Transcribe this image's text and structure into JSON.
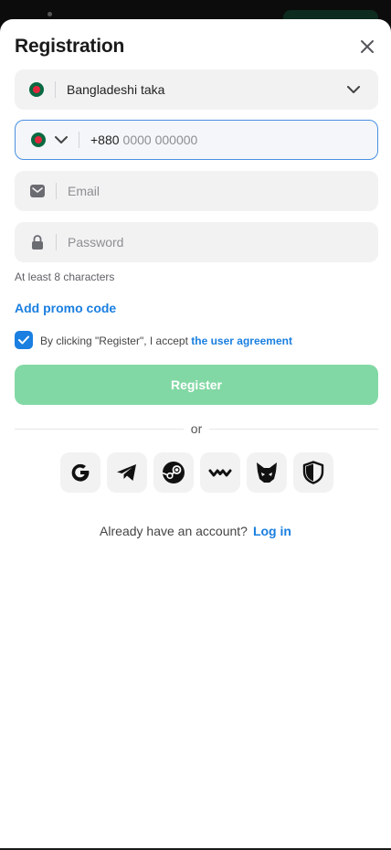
{
  "header": {
    "title": "Registration"
  },
  "currency": {
    "value": "Bangladeshi taka",
    "flag": "bangladesh-flag"
  },
  "phone": {
    "code": "+880",
    "placeholder": "0000 000000"
  },
  "email": {
    "placeholder": "Email"
  },
  "password": {
    "placeholder": "Password",
    "hint": "At least 8 characters"
  },
  "promo": {
    "label": "Add promo code"
  },
  "agreement": {
    "text": "By clicking \"Register\", I accept",
    "link": "the user agreement",
    "checked": true
  },
  "register": {
    "label": "Register"
  },
  "divider": {
    "label": "or"
  },
  "socials": [
    {
      "name": "google-icon"
    },
    {
      "name": "telegram-icon"
    },
    {
      "name": "steam-icon"
    },
    {
      "name": "wallet-icon"
    },
    {
      "name": "metamask-icon"
    },
    {
      "name": "shield-icon"
    }
  ],
  "footer": {
    "question": "Already have an account?",
    "login": "Log in"
  },
  "colors": {
    "accent": "#1a7fe0",
    "register_bg": "#82d8a4",
    "field_bg": "#f2f2f3",
    "focus_border": "#4a90e2"
  }
}
